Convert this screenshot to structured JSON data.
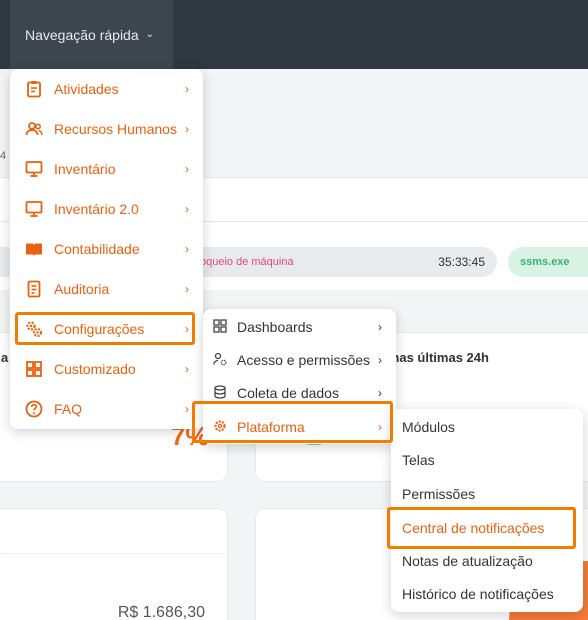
{
  "topbar": {
    "nav_label": "Navegação rápida",
    "chevron": "chevron-down-icon"
  },
  "background": {
    "small_number": "4",
    "pill_event": "oqueio de máquina",
    "pill_time": "35:33:45",
    "pill_app": "ssms.exe",
    "card_left_title": "a",
    "card_left_value": "7%",
    "card_right_title": "eta nas últimas 24h",
    "amount": "R$ 1.686,30"
  },
  "menu_main": {
    "items": [
      {
        "label": "Atividades",
        "icon": "clipboard-icon"
      },
      {
        "label": "Recursos Humanos",
        "icon": "users-icon"
      },
      {
        "label": "Inventário",
        "icon": "monitor-icon"
      },
      {
        "label": "Inventário 2.0",
        "icon": "monitor-icon"
      },
      {
        "label": "Contabilidade",
        "icon": "book-icon"
      },
      {
        "label": "Auditoria",
        "icon": "audit-icon"
      },
      {
        "label": "Configurações",
        "icon": "gears-icon"
      },
      {
        "label": "Customizado",
        "icon": "grid-icon"
      },
      {
        "label": "FAQ",
        "icon": "question-icon"
      }
    ],
    "arrow": "›"
  },
  "menu_sub": {
    "items": [
      {
        "label": "Dashboards",
        "icon": "dashboard-icon"
      },
      {
        "label": "Acesso e permissões",
        "icon": "user-gear-icon"
      },
      {
        "label": "Coleta de dados",
        "icon": "database-icon"
      },
      {
        "label": "Plataforma",
        "icon": "gear-icon"
      }
    ]
  },
  "menu_platform": {
    "items": [
      "Módulos",
      "Telas",
      "Permissões",
      "Central de notificações",
      "Notas de atualização",
      "Histórico de notificações"
    ]
  },
  "colors": {
    "accent": "#e8610f",
    "highlight": "#f07c00",
    "topbar": "#2f3740"
  }
}
